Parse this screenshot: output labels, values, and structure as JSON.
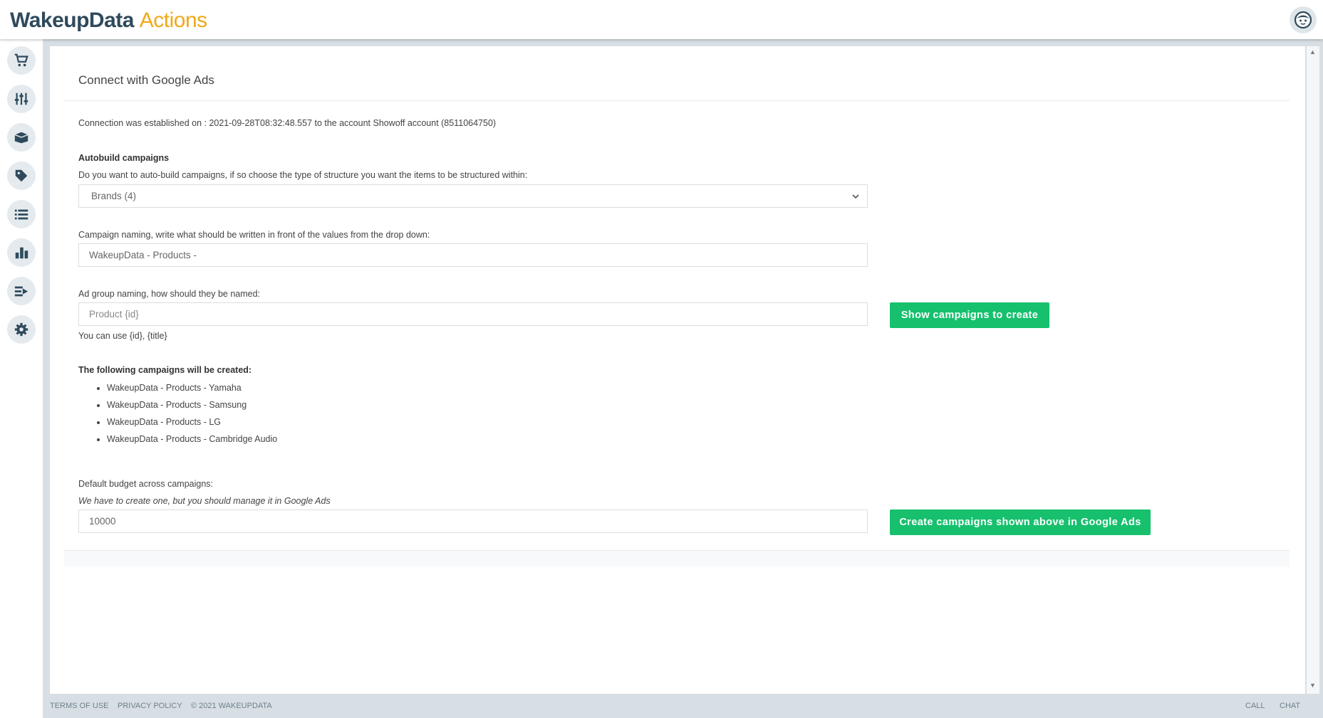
{
  "app": {
    "brand_primary": "WakeupData",
    "brand_secondary": "Actions",
    "colors": {
      "brand_dark": "#2f4a5c",
      "brand_accent": "#f0a818",
      "action_green": "#16c06d"
    }
  },
  "sidebar": {
    "items": [
      {
        "icon": "cart-icon"
      },
      {
        "icon": "sliders-icon"
      },
      {
        "icon": "box-icon"
      },
      {
        "icon": "tag-icon"
      },
      {
        "icon": "list-icon"
      },
      {
        "icon": "bar-chart-icon"
      },
      {
        "icon": "export-icon"
      },
      {
        "icon": "gear-icon"
      }
    ]
  },
  "main": {
    "title": "Connect with Google Ads",
    "connection_text": "Connection was established on : 2021-09-28T08:32:48.557 to the account Showoff account (8511064750)",
    "autobuild": {
      "heading": "Autobuild campaigns",
      "description": "Do you want to auto-build campaigns, if so choose the type of structure you want the items to be structured within:",
      "selected": "Brands (4)"
    },
    "campaign_naming": {
      "label": "Campaign naming, write what should be written in front of the values from the drop down:",
      "value": "WakeupData - Products -"
    },
    "adgroup_naming": {
      "label": "Ad group naming, how should they be named:",
      "placeholder": "Product {id}",
      "hint": "You can use {id}, {title}",
      "button": "Show campaigns to create"
    },
    "campaigns": {
      "heading": "The following campaigns will be created:",
      "items": [
        "WakeupData - Products - Yamaha",
        "WakeupData - Products - Samsung",
        "WakeupData - Products - LG",
        "WakeupData - Products - Cambridge Audio"
      ]
    },
    "budget": {
      "label": "Default budget across campaigns:",
      "note": "We have to create one, but you should manage it in Google Ads",
      "value": "10000",
      "button": "Create campaigns shown above in Google Ads"
    }
  },
  "footer": {
    "terms": "TERMS OF USE",
    "privacy": "PRIVACY POLICY",
    "copyright": "© 2021 WAKEUPDATA",
    "call": "CALL",
    "chat": "CHAT"
  }
}
